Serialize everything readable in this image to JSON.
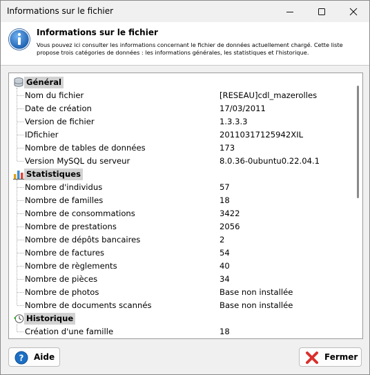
{
  "window": {
    "title": "Informations sur le fichier"
  },
  "header": {
    "title": "Informations sur le fichier",
    "description": "Vous pouvez ici consulter les informations concernant le fichier de données actuellement chargé. Cette liste propose trois catégories de données : les informations générales, les statistiques et l'historique."
  },
  "categories": [
    {
      "label": "Général",
      "icon": "database-icon",
      "items": [
        {
          "label": "Nom du fichier",
          "value": "[RESEAU]cdl_mazerolles"
        },
        {
          "label": "Date de création",
          "value": "17/03/2011"
        },
        {
          "label": "Version de fichier",
          "value": "1.3.3.3"
        },
        {
          "label": "IDfichier",
          "value": "20110317125942XIL"
        },
        {
          "label": "Nombre de tables de données",
          "value": "173"
        },
        {
          "label": "Version MySQL du serveur",
          "value": "8.0.36-0ubuntu0.22.04.1"
        }
      ]
    },
    {
      "label": "Statistiques",
      "icon": "bar-chart-icon",
      "items": [
        {
          "label": "Nombre d'individus",
          "value": "57"
        },
        {
          "label": "Nombre de familles",
          "value": "18"
        },
        {
          "label": "Nombre de consommations",
          "value": "3422"
        },
        {
          "label": "Nombre de prestations",
          "value": "2056"
        },
        {
          "label": "Nombre de dépôts bancaires",
          "value": "2"
        },
        {
          "label": "Nombre de factures",
          "value": "54"
        },
        {
          "label": "Nombre de règlements",
          "value": "40"
        },
        {
          "label": "Nombre de pièces",
          "value": "34"
        },
        {
          "label": "Nombre de photos",
          "value": "Base non installée"
        },
        {
          "label": "Nombre de documents scannés",
          "value": "Base non installée"
        }
      ]
    },
    {
      "label": "Historique",
      "icon": "history-clock-icon",
      "items": [
        {
          "label": "Création d'une famille",
          "value": "18"
        }
      ]
    }
  ],
  "buttons": {
    "help": "Aide",
    "close": "Fermer"
  },
  "colors": {
    "accent": "#1c6fc4",
    "close_red": "#d9302c",
    "highlight": "#d2d2d2"
  }
}
